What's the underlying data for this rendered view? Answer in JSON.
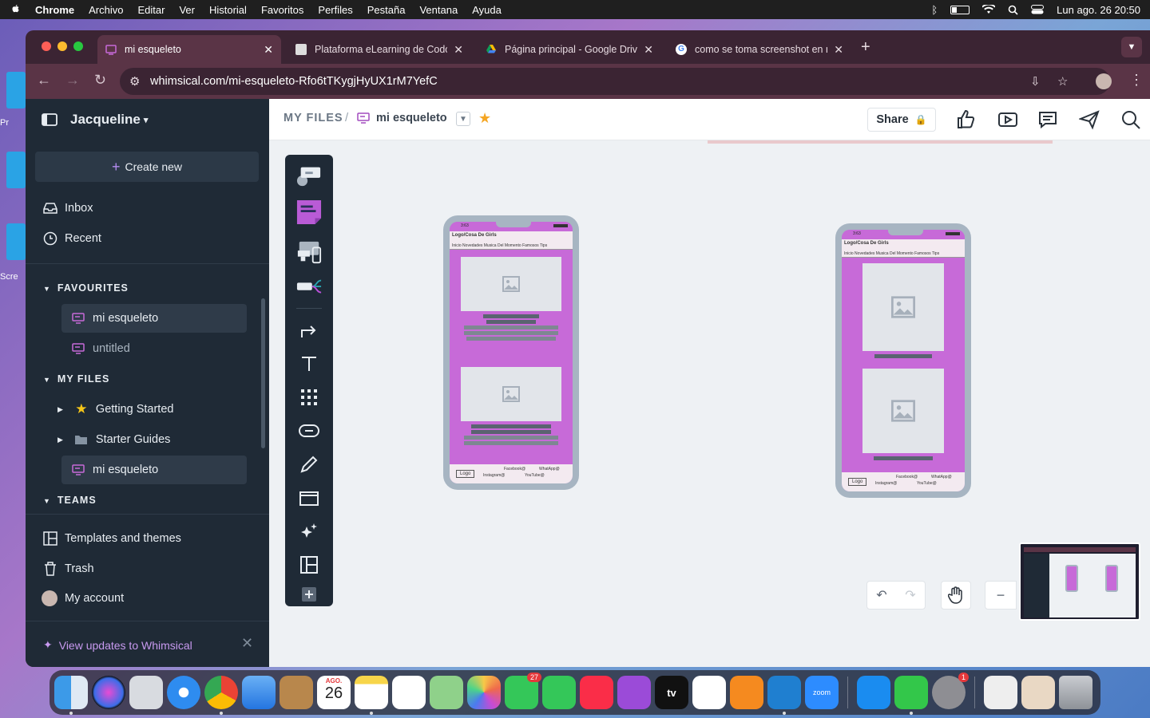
{
  "menubar": {
    "app": "Chrome",
    "items": [
      "Archivo",
      "Editar",
      "Ver",
      "Historial",
      "Favoritos",
      "Perfiles",
      "Pestaña",
      "Ventana",
      "Ayuda"
    ],
    "datetime": "Lun ago. 26  20:50"
  },
  "desktop": {
    "label1": "Pr",
    "label2": "Scre"
  },
  "tabs": [
    {
      "title": "mi esqueleto",
      "active": true
    },
    {
      "title": "Plataforma eLearning de Codo",
      "active": false
    },
    {
      "title": "Página principal - Google Drive",
      "active": false
    },
    {
      "title": "como se toma screenshot en mac",
      "active": false
    }
  ],
  "address": {
    "url": "whimsical.com/mi-esqueleto-Rfo6tTKygjHyUX1rM7YefC"
  },
  "sidebar": {
    "workspace": "Jacqueline",
    "create_new": "Create new",
    "inbox": "Inbox",
    "recent": "Recent",
    "favourites_header": "FAVOURITES",
    "favourites": [
      "mi esqueleto",
      "untitled"
    ],
    "myfiles_header": "MY FILES",
    "myfiles": [
      "Getting Started",
      "Starter Guides",
      "mi esqueleto"
    ],
    "teams_header": "TEAMS",
    "templates": "Templates and themes",
    "trash": "Trash",
    "account": "My account",
    "updates": "View updates to Whimsical"
  },
  "header": {
    "crumb": "MY FILES",
    "separator": "/",
    "filename": "mi esqueleto",
    "share": "Share"
  },
  "wireframe": {
    "time": "3:63",
    "title": "Logo/Cosa De Girls",
    "nav": "Inicio  Novedades  Musica Del Momento  Famosos  Tips",
    "logo": "Logo",
    "facebook": "Facebook@",
    "whatsapp": "WhatApp@",
    "instagram": "Instagram@",
    "youtube": "YouTube@"
  },
  "dock": {
    "calendar_month": "AGO.",
    "calendar_day": "26",
    "messages_badge": "27",
    "settings_badge": "1",
    "zoom_label": "zoom"
  },
  "colors": {
    "sidebar": "#1f2a36",
    "accent_purple": "#c76ad8",
    "chrome_tab": "#5a3446",
    "canvas": "#eef1f4"
  }
}
